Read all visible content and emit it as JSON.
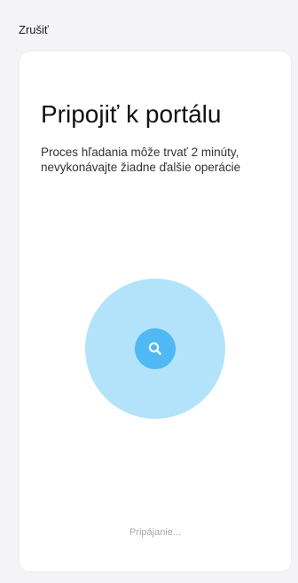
{
  "header": {
    "cancel_label": "Zrušiť"
  },
  "card": {
    "title": "Pripojiť k portálu",
    "description": "Proces hľadania môže trvať 2 minúty, nevykonávajte žiadne ďalšie operácie",
    "status": "Pripájanie...",
    "search_icon": "search-icon"
  },
  "colors": {
    "background": "#f4f4f6",
    "card": "#ffffff",
    "pulse_circle": "#b3e3fb",
    "accent": "#4fb8f5",
    "status_text": "#a8a8a8"
  }
}
